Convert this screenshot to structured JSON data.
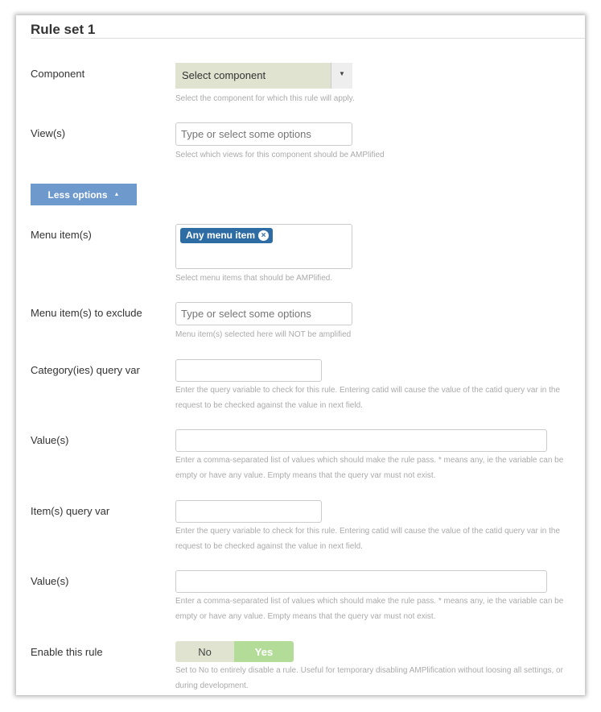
{
  "panel": {
    "title": "Rule set 1"
  },
  "fields": {
    "component": {
      "label": "Component",
      "value": "Select component",
      "help": "Select the component for which this rule will apply."
    },
    "views": {
      "label": "View(s)",
      "placeholder": "Type or select some options",
      "help": "Select which views for this component should be AMPlified"
    },
    "less_options": {
      "label": "Less options",
      "icon": "caret-up-icon"
    },
    "menu_items": {
      "label": "Menu item(s)",
      "selected": [
        "Any menu item"
      ],
      "help": "Select menu items that should be AMPlified."
    },
    "menu_items_exclude": {
      "label": "Menu item(s) to exclude",
      "placeholder": "Type or select some options",
      "help": "Menu item(s) selected here will NOT be amplified"
    },
    "category_query_var": {
      "label": "Category(ies) query var",
      "value": "",
      "help": "Enter the query variable to check for this rule. Entering catid will cause the value of the catid query var in the request to be checked against the value in next field."
    },
    "category_values": {
      "label": "Value(s)",
      "value": "",
      "help": "Enter a comma-separated list of values which should make the rule pass. * means any, ie the variable can be empty or have any value. Empty means that the query var must not exist."
    },
    "item_query_var": {
      "label": "Item(s) query var",
      "value": "",
      "help": "Enter the query variable to check for this rule. Entering catid will cause the value of the catid query var in the request to be checked against the value in next field."
    },
    "item_values": {
      "label": "Value(s)",
      "value": "",
      "help": "Enter a comma-separated list of values which should make the rule pass. * means any, ie the variable can be empty or have any value. Empty means that the query var must not exist."
    },
    "enable_rule": {
      "label": "Enable this rule",
      "options": [
        "No",
        "Yes"
      ],
      "selected": "Yes",
      "help": "Set to No to entirely disable a rule. Useful for temporary disabling AMPlification without loosing all settings, or during development."
    }
  },
  "colors": {
    "button_blue": "#6e99cc",
    "chip_blue": "#2e6ca4",
    "select_bg": "#dfe3d0",
    "toggle_yes": "#b4dc99"
  }
}
